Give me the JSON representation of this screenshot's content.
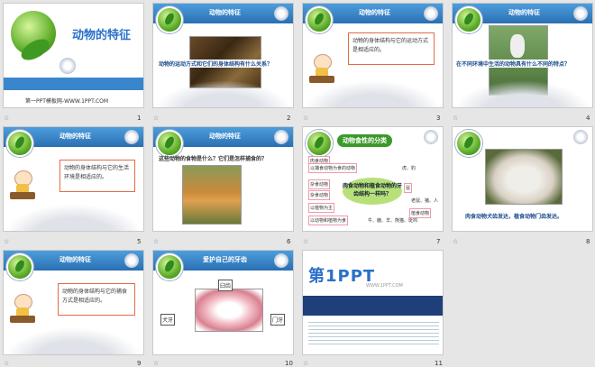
{
  "slides": [
    {
      "number": "1",
      "title": "动物的特征",
      "footer": "第一PPT模板网-WWW.1PPT.COM"
    },
    {
      "number": "2",
      "title": "动物的特征",
      "question": "动物的运动方式和它们的身体结构有什么关系？"
    },
    {
      "number": "3",
      "title": "动物的特征",
      "callout": "动物的身体结构与它的运动方式是相适应的。"
    },
    {
      "number": "4",
      "title": "动物的特征",
      "question": "在不同环境中生活的动物具有什么不同的特点？"
    },
    {
      "number": "5",
      "title": "动物的特征",
      "callout": "动物的身体结构与它的生活环境是相适应的。"
    },
    {
      "number": "6",
      "title": "动物的特征",
      "question": "这些动物的食物是什么？它们是怎样捕食的？"
    },
    {
      "number": "7",
      "title": "动物食性的分类",
      "center": "肉食动物和植食动物的牙齿结构一样吗？",
      "labels": [
        "肉食动物",
        "以捕食动物为食的动物",
        "虎、豹",
        "杂食动物",
        "以植物为主",
        "鼠",
        "老鼠、猪、人",
        "杂食动物",
        "以动物和植物为食",
        "牛、鹿、羊、熊猫、斑鸠",
        "植食动物"
      ]
    },
    {
      "number": "8",
      "title": "动物的特征",
      "question": "肉食动物犬齿发达，植食动物门齿发达。"
    },
    {
      "number": "9",
      "title": "动物的特征",
      "callout": "动物的身体结构与它的捕食方式是相适应的。"
    },
    {
      "number": "10",
      "title": "爱护自己的牙齿",
      "labels": [
        "臼齿",
        "犬牙",
        "门牙"
      ]
    },
    {
      "number": "11",
      "logo": "第1PPT",
      "url_text": "WWW.1PPT.COM"
    }
  ]
}
